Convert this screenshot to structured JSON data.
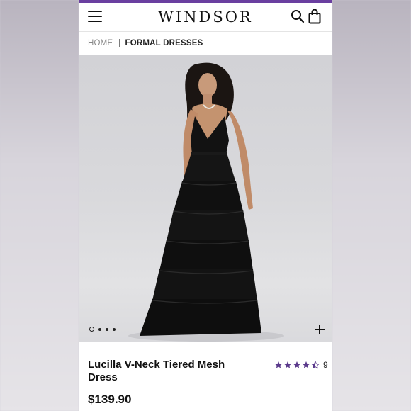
{
  "header": {
    "brand": "WINDSOR",
    "menu_icon": "hamburger-menu-icon",
    "search_icon": "search-icon",
    "bag_icon": "shopping-bag-icon",
    "accent_color": "#6a3fa0"
  },
  "breadcrumb": {
    "home": "HOME",
    "separator": "|",
    "current": "FORMAL DRESSES"
  },
  "gallery": {
    "image_alt": "model wearing black tiered mesh gown",
    "dot_count": 4,
    "active_dot": 0,
    "zoom_icon": "plus-icon"
  },
  "product": {
    "name": "Lucilla V-Neck Tiered Mesh Dress",
    "price": "$139.90",
    "rating": 4.5,
    "review_count": "9",
    "star_color": "#5b3a8c"
  }
}
